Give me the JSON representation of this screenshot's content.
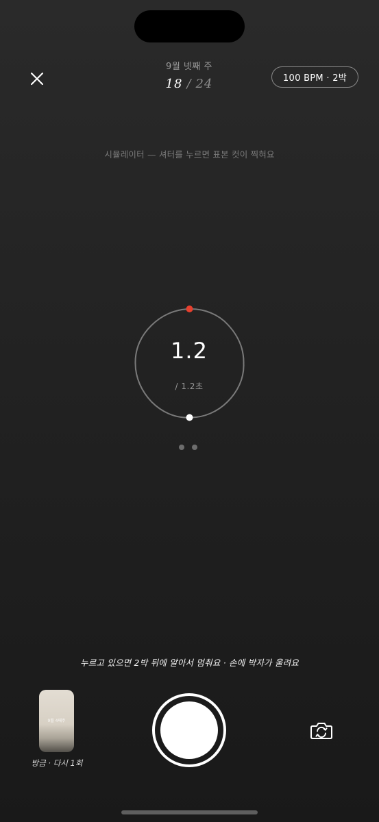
{
  "header": {
    "week_label": "9월 넷째 주",
    "counter_current": "18",
    "counter_separator": "/",
    "counter_total": "24",
    "bpm_label": "100 BPM · 2박"
  },
  "simulator_note": "시뮬레이터 — 셔터를 누르면 표본 컷이 찍혀요",
  "timer": {
    "value": "1.2",
    "total": "/ 1.2초",
    "progress": 1.0,
    "accent_color": "#e8402e"
  },
  "pager": {
    "count": 2
  },
  "hint": "누르고 있으면 2박 뒤에 알아서 멈춰요 · 손에 박자가 울려요",
  "last_shot": {
    "thumb_text": "9월 4째주",
    "label": "방금 · 다시 1회"
  },
  "icons": {
    "close": "close-icon",
    "flip_camera": "flip-camera-icon"
  }
}
